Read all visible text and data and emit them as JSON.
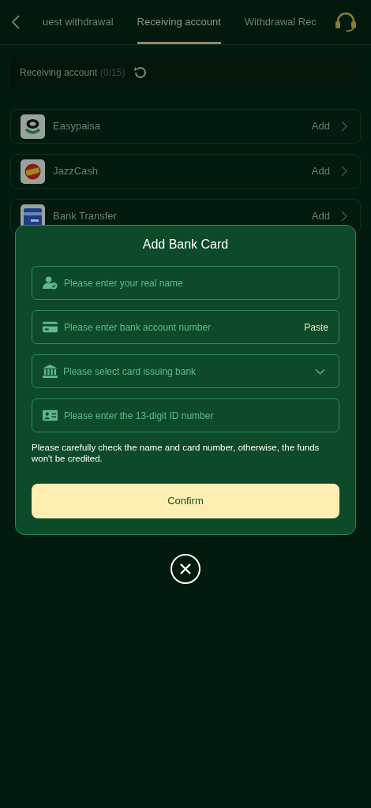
{
  "tabs": [
    {
      "label": "uest withdrawal",
      "selected": false
    },
    {
      "label": "Receiving account",
      "selected": true
    },
    {
      "label": "Withdrawal Rec",
      "selected": false
    }
  ],
  "account_summary": {
    "label": "Receiving account",
    "count": "(0/15)"
  },
  "methods": [
    {
      "name": "Easypaisa",
      "action": "Add"
    },
    {
      "name": "JazzCash",
      "action": "Add"
    },
    {
      "name": "Bank Transfer",
      "action": "Add"
    }
  ],
  "dialog": {
    "title": "Add Bank Card",
    "fields": [
      {
        "kind": "text",
        "placeholder": "Please enter your real name"
      },
      {
        "kind": "paste",
        "placeholder": "Please enter bank account number",
        "action": "Paste"
      },
      {
        "kind": "select",
        "placeholder": "Please select card issuing bank"
      },
      {
        "kind": "text",
        "placeholder": "Please enter the 13-digit ID number"
      }
    ],
    "note": "Please carefully check the name and card number, otherwise, the funds won't be credited.",
    "confirm": "Confirm"
  }
}
